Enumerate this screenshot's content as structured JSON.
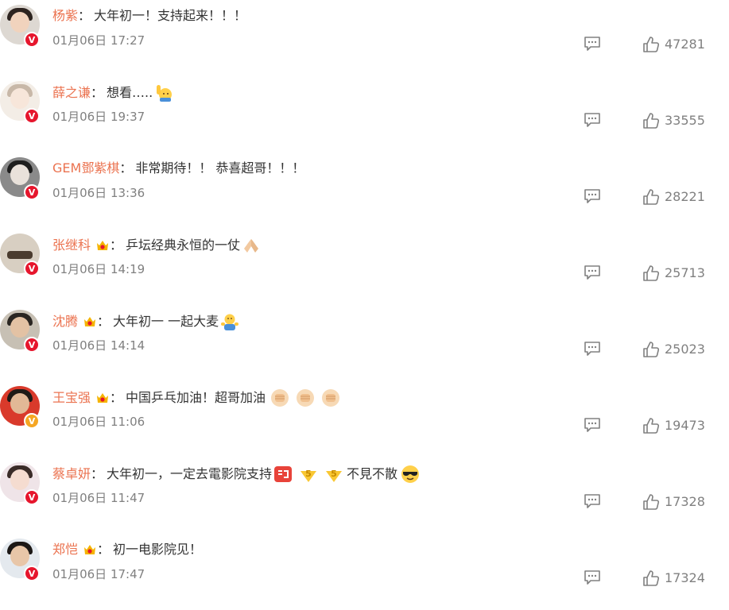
{
  "colors": {
    "username": "#eb7350",
    "meta": "#808080",
    "verified_red": "#e6162d",
    "verified_orange": "#f5a623"
  },
  "comments": [
    {
      "username": "杨紫",
      "colon": "：",
      "text": "大年初一！支持起来！！！",
      "time": "01月06日 17:27",
      "likes": "47281",
      "badge": "V",
      "badge_color": "verified_red",
      "crown": false,
      "emojis": []
    },
    {
      "username": "薛之谦",
      "colon": "：",
      "text": "想看…..",
      "time": "01月06日 19:37",
      "likes": "33555",
      "badge": "V",
      "badge_color": "verified_red",
      "crown": false,
      "emojis": [
        "raise-hand-emoji"
      ]
    },
    {
      "username": "GEM鄧紫棋",
      "colon": "：",
      "text": "非常期待！！ 恭喜超哥！！！",
      "time": "01月06日 13:36",
      "likes": "28221",
      "badge": "V",
      "badge_color": "verified_red",
      "crown": false,
      "emojis": []
    },
    {
      "username": "张继科",
      "colon": "：",
      "text": "乒坛经典永恒的一仗",
      "time": "01月06日 14:19",
      "likes": "25713",
      "badge": "V",
      "badge_color": "verified_red",
      "crown": true,
      "emojis": [
        "pray-emoji"
      ]
    },
    {
      "username": "沈腾",
      "colon": "：",
      "text": "大年初一 一起大麦",
      "time": "01月06日 14:14",
      "likes": "25023",
      "badge": "V",
      "badge_color": "verified_red",
      "crown": true,
      "emojis": [
        "shrug-emoji"
      ]
    },
    {
      "username": "王宝强",
      "colon": "：",
      "text": "中国乒乓加油！超哥加油",
      "time": "01月06日 11:06",
      "likes": "19473",
      "badge": "V",
      "badge_color": "verified_orange",
      "crown": true,
      "emojis": [
        "fist-emoji",
        "fist-emoji",
        "fist-emoji"
      ]
    },
    {
      "username": "蔡卓妍",
      "colon": "：",
      "text": "大年初一，一定去電影院支持",
      "time": "01月06日 11:47",
      "likes": "17328",
      "badge": "V",
      "badge_color": "verified_red",
      "crown": false,
      "emojis": [
        "hongbao-sticker-emoji",
        "five-down-emoji",
        "five-down-emoji"
      ],
      "tail_text": "不見不散",
      "tail_emojis": [
        "cool-sunglasses-emoji"
      ]
    },
    {
      "username": "郑恺",
      "colon": "：",
      "text": "初一电影院见！",
      "time": "01月06日 17:47",
      "likes": "17324",
      "badge": "V",
      "badge_color": "verified_red",
      "crown": true,
      "emojis": []
    }
  ]
}
